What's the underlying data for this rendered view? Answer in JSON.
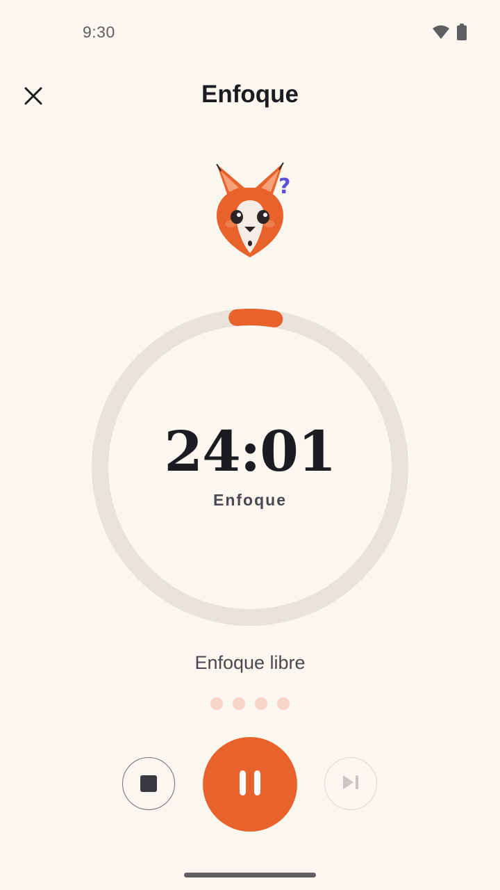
{
  "status_bar": {
    "time": "9:30",
    "icons": [
      "wifi-icon",
      "battery-icon"
    ]
  },
  "header": {
    "title": "Enfoque",
    "close_icon": "close-icon"
  },
  "mascot": {
    "icon": "fox-confused-icon"
  },
  "timer": {
    "time": "24:01",
    "mode_label": "Enfoque",
    "progress_fraction": 0.04
  },
  "session": {
    "name": "Enfoque libre",
    "rounds_total": 4,
    "rounds_completed": 0
  },
  "controls": {
    "stop_icon": "stop-icon",
    "pause_icon": "pause-icon",
    "skip_icon": "skip-next-icon"
  },
  "colors": {
    "accent": "#e8622b",
    "ring_track": "#e8e2d8",
    "background": "#faf6f0",
    "dot_inactive": "#f7d6c6"
  }
}
